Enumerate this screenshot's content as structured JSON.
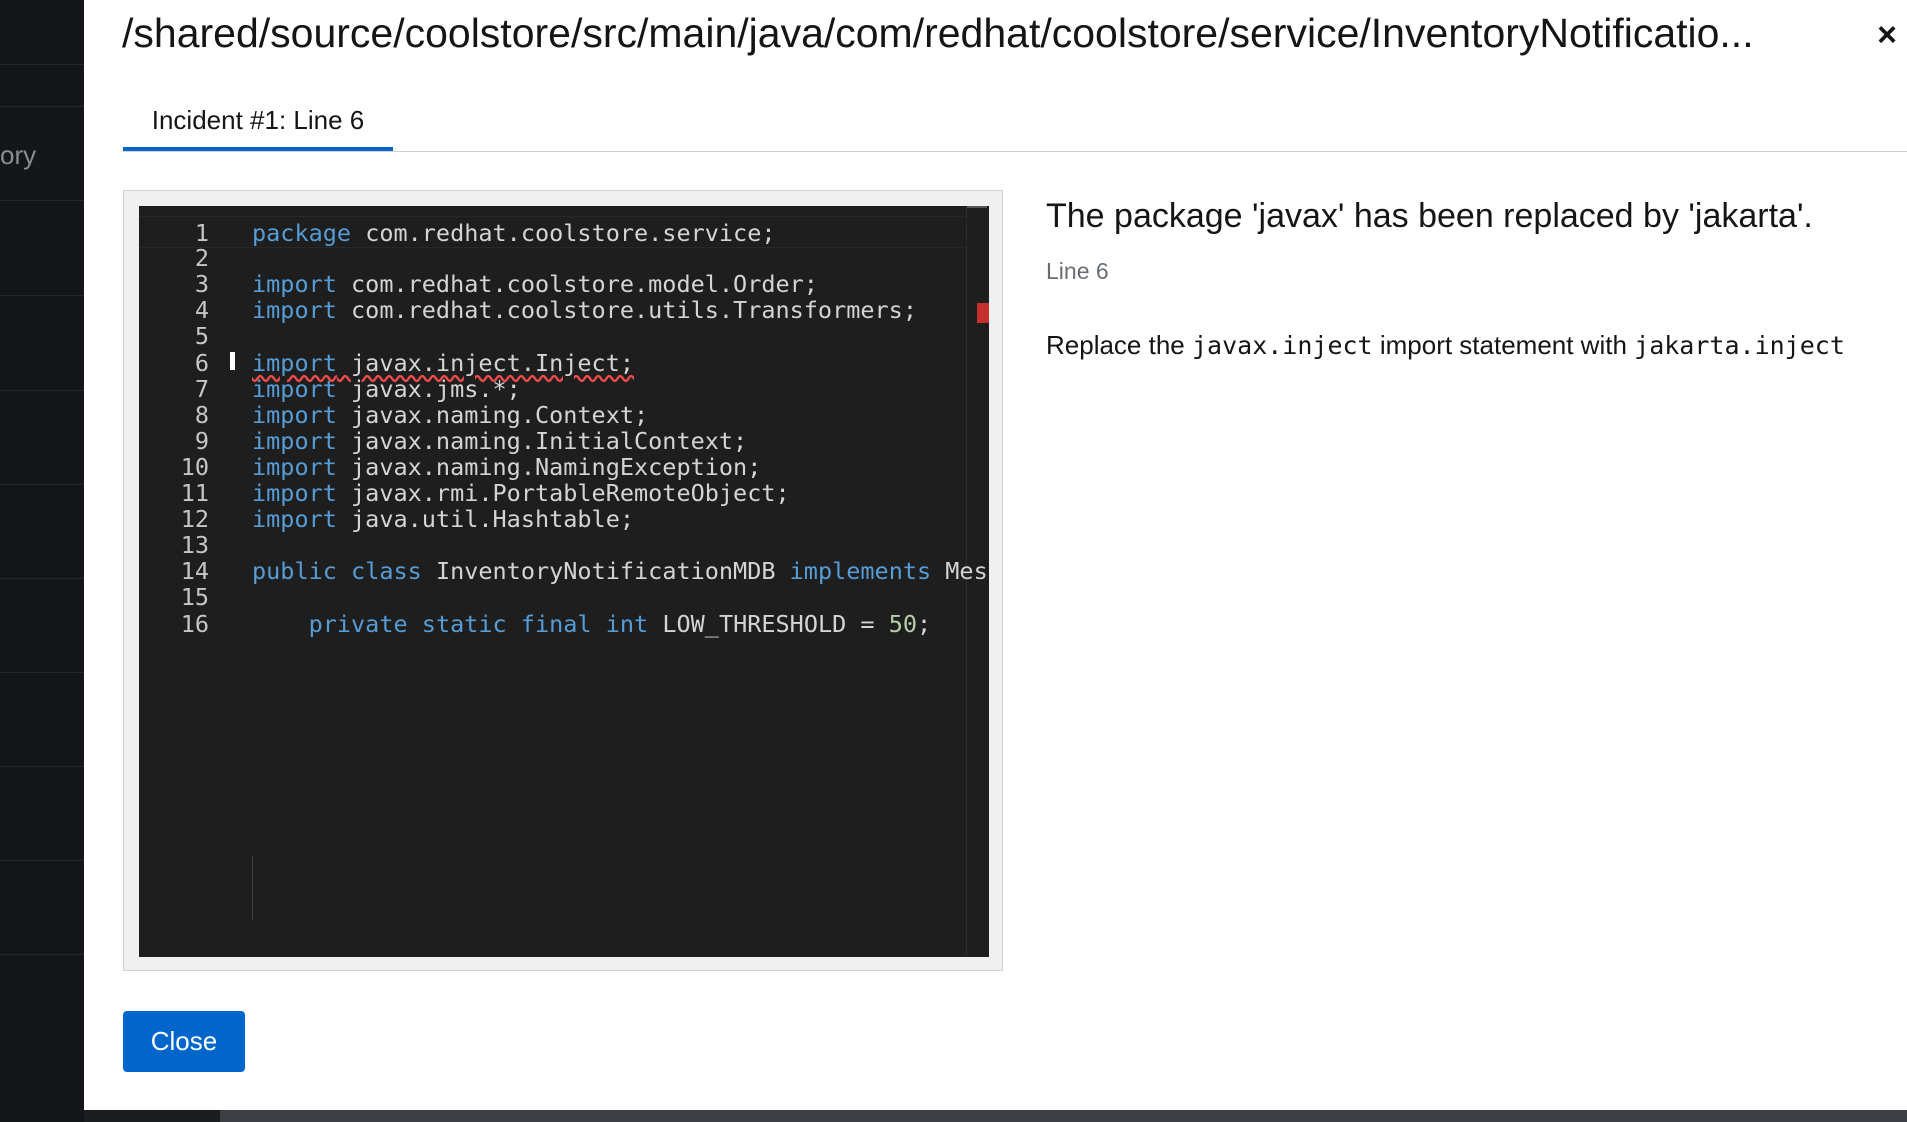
{
  "background": {
    "sidebar_fragment": "ory"
  },
  "modal": {
    "title": "/shared/source/coolstore/src/main/java/com/redhat/coolstore/service/InventoryNotificatio...",
    "close_icon": "×",
    "tab_label": "Incident #1: Line 6",
    "close_button": "Close"
  },
  "editor": {
    "lines": [
      {
        "n": "1",
        "kw": "package",
        "rest": " com.redhat.coolstore.service;"
      },
      {
        "n": "2",
        "kw": "",
        "rest": ""
      },
      {
        "n": "3",
        "kw": "import",
        "rest": " com.redhat.coolstore.model.Order;"
      },
      {
        "n": "4",
        "kw": "import",
        "rest": " com.redhat.coolstore.utils.Transformers;"
      },
      {
        "n": "5",
        "kw": "",
        "rest": ""
      },
      {
        "n": "6",
        "kw": "import",
        "rest": " javax.inject.Inject;"
      },
      {
        "n": "7",
        "kw": "import",
        "rest": " javax.jms.*;"
      },
      {
        "n": "8",
        "kw": "import",
        "rest": " javax.naming.Context;"
      },
      {
        "n": "9",
        "kw": "import",
        "rest": " javax.naming.InitialContext;"
      },
      {
        "n": "10",
        "kw": "import",
        "rest": " javax.naming.NamingException;"
      },
      {
        "n": "11",
        "kw": "import",
        "rest": " javax.rmi.PortableRemoteObject;"
      },
      {
        "n": "12",
        "kw": "import",
        "rest": " java.util.Hashtable;"
      },
      {
        "n": "13",
        "kw": "",
        "rest": ""
      },
      {
        "n": "14",
        "kw": "public",
        "kw2": "class",
        "mid": " InventoryNotificationMDB ",
        "kw3": "implements",
        "rest": " Mess"
      },
      {
        "n": "15",
        "kw": "",
        "rest": ""
      },
      {
        "n": "16",
        "indent": "    ",
        "kw": "private static final int",
        "rest": " LOW_THRESHOLD = ",
        "num": "50",
        "tail": ";"
      }
    ]
  },
  "incident": {
    "title": "The package 'javax' has been replaced by 'jakarta'.",
    "line": "Line 6",
    "text_before": "Replace the ",
    "code1": "javax.inject",
    "text_middle": " import statement with ",
    "code2": "jakarta.inject"
  },
  "colors": {
    "accent": "#0066cc",
    "error": "#c72e2e",
    "keyword": "#569cd6",
    "number": "#b5cea8"
  }
}
